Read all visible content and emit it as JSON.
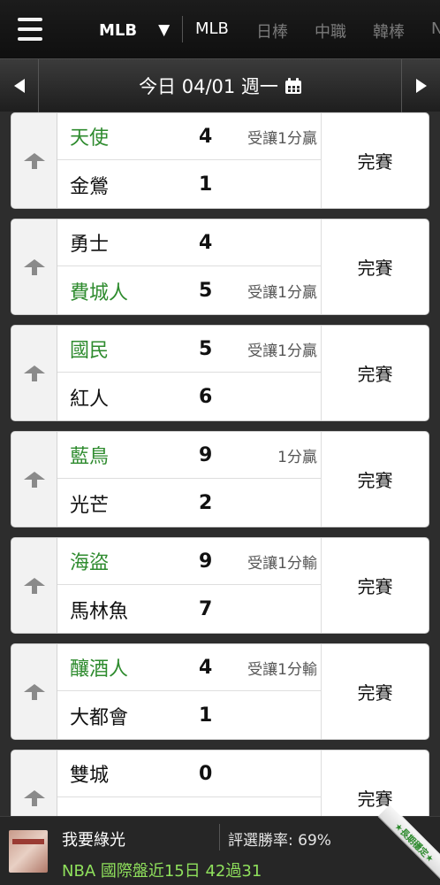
{
  "topbar": {
    "league_select": "MLB",
    "tabs": [
      {
        "label": "MLB",
        "active": true
      },
      {
        "label": "日棒",
        "active": false
      },
      {
        "label": "中職",
        "active": false
      },
      {
        "label": "韓棒",
        "active": false
      },
      {
        "label": "N",
        "active": false
      }
    ]
  },
  "datebar": {
    "date_label": "今日 04/01 週一"
  },
  "games": [
    {
      "home": {
        "name": "天使",
        "score": "4",
        "odds": "受讓1分贏",
        "highlight": true
      },
      "away": {
        "name": "金鶯",
        "score": "1",
        "odds": "",
        "highlight": false
      },
      "status": "完賽"
    },
    {
      "home": {
        "name": "勇士",
        "score": "4",
        "odds": "",
        "highlight": false
      },
      "away": {
        "name": "費城人",
        "score": "5",
        "odds": "受讓1分贏",
        "highlight": true
      },
      "status": "完賽"
    },
    {
      "home": {
        "name": "國民",
        "score": "5",
        "odds": "受讓1分贏",
        "highlight": true
      },
      "away": {
        "name": "紅人",
        "score": "6",
        "odds": "",
        "highlight": false
      },
      "status": "完賽"
    },
    {
      "home": {
        "name": "藍鳥",
        "score": "9",
        "odds": "1分贏",
        "highlight": true
      },
      "away": {
        "name": "光芒",
        "score": "2",
        "odds": "",
        "highlight": false
      },
      "status": "完賽"
    },
    {
      "home": {
        "name": "海盜",
        "score": "9",
        "odds": "受讓1分輸",
        "highlight": true
      },
      "away": {
        "name": "馬林魚",
        "score": "7",
        "odds": "",
        "highlight": false
      },
      "status": "完賽"
    },
    {
      "home": {
        "name": "釀酒人",
        "score": "4",
        "odds": "受讓1分輸",
        "highlight": true
      },
      "away": {
        "name": "大都會",
        "score": "1",
        "odds": "",
        "highlight": false
      },
      "status": "完賽"
    },
    {
      "home": {
        "name": "雙城",
        "score": "0",
        "odds": "",
        "highlight": false
      },
      "away": {
        "name": "",
        "score": "",
        "odds": "",
        "highlight": false
      },
      "status": "完賽"
    }
  ],
  "banner": {
    "title": "我要綠光",
    "win_rate": "評選勝率: 69%",
    "promo": "NBA 國際盤近15日 42過31",
    "ribbon": "★長期穩定★"
  },
  "colors": {
    "highlight_team": "#2e8b2e",
    "promo_text": "#8fe05c"
  }
}
